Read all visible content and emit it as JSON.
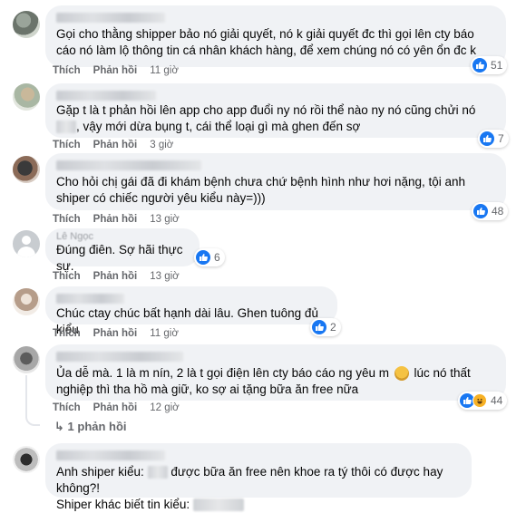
{
  "comments": [
    {
      "text": "Gọi cho thằng shipper bảo nó giải quyết, nó k giải quyết đc thì gọi lên cty báo cáo nó làm lộ thông tin cá nhân khách hàng, để xem chúng nó có yên ổn đc k",
      "like": "Thích",
      "reply": "Phản hồi",
      "time": "11 giờ",
      "reactions": "51"
    },
    {
      "text_a": "Gặp t là t phản hồi lên app cho app đuổi ny nó rồi thể nào ny nó cũng chửi nó",
      "text_b": ", vậy mới dừa bụng t, cái thể loại gì mà ghen đến sợ",
      "like": "Thích",
      "reply": "Phản hồi",
      "time": "3 giờ",
      "reactions": "7"
    },
    {
      "text": "Cho hỏi chị gái đã đi khám bệnh chưa chứ bệnh hình như hơi nặng, tội anh shiper có chiếc người yêu kiểu này=)))",
      "like": "Thích",
      "reply": "Phản hồi",
      "time": "13 giờ",
      "reactions": "48"
    },
    {
      "name": "Lê Ngọc",
      "text": "Đúng điên. Sợ hãi thực sự.",
      "like": "Thích",
      "reply": "Phản hồi",
      "time": "13 giờ",
      "reactions": "6"
    },
    {
      "text": "Chúc ctay chúc bất hạnh dài lâu. Ghen tuông đủ kiểu",
      "like": "Thích",
      "reply": "Phản hồi",
      "time": "11 giờ",
      "reactions": "2"
    },
    {
      "text_a": "Ủa dễ mà. 1 là m nín, 2 là t gọi điện lên cty báo cáo ng yêu m",
      "text_b": "lúc nó thất nghiệp thì tha hồ mà giữ, ko sợ ai tặng bữa ăn free nữa",
      "like": "Thích",
      "reply": "Phản hồi",
      "time": "12 giờ",
      "reactions": "44",
      "replies_link": "1 phản hồi"
    },
    {
      "text_a": "Anh shiper kiểu:",
      "text_b": "được bữa ăn free nên khoe ra tý thôi có được hay không?!",
      "text_c": "Shiper khác biết tin kiểu:"
    }
  ],
  "colors": {
    "bubble": "#f0f2f5",
    "like": "#1877f2",
    "meta": "#65676b"
  },
  "icons": [
    "like-icon",
    "haha-icon",
    "reply-arrow-icon",
    "default-avatar-icon"
  ]
}
